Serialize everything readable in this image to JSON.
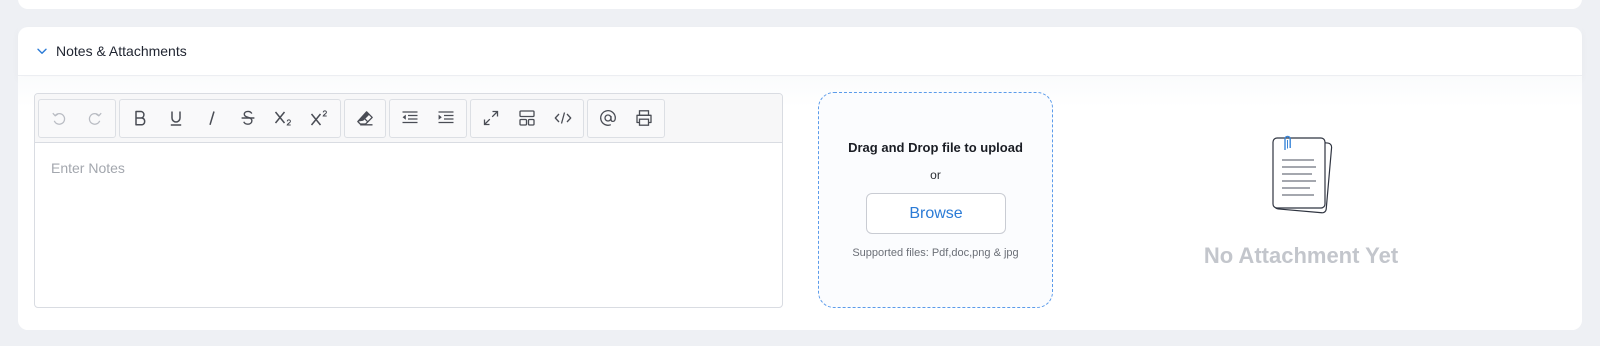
{
  "section": {
    "title": "Notes & Attachments",
    "toggle_icon": "chevron-down-icon"
  },
  "editor": {
    "placeholder": "Enter Notes",
    "toolbar_groups": [
      [
        "undo-icon",
        "redo-icon"
      ],
      [
        "bold-icon",
        "underline-icon",
        "italic-icon",
        "strikethrough-icon",
        "subscript-icon",
        "superscript-icon"
      ],
      [
        "eraser-icon"
      ],
      [
        "outdent-icon",
        "indent-icon"
      ],
      [
        "fullscreen-icon",
        "layout-icon",
        "code-view-icon"
      ],
      [
        "mention-icon",
        "print-icon"
      ]
    ]
  },
  "upload": {
    "title": "Drag and Drop file to upload",
    "or_text": "or",
    "browse_label": "Browse",
    "supported_text": "Supported files: Pdf,doc,png & jpg",
    "border_color": "#5b9bea"
  },
  "attachments": {
    "empty_text": "No Attachment Yet",
    "empty_icon": "document-icon"
  },
  "colors": {
    "accent": "#2b7bd6",
    "background": "#eef0f4"
  }
}
